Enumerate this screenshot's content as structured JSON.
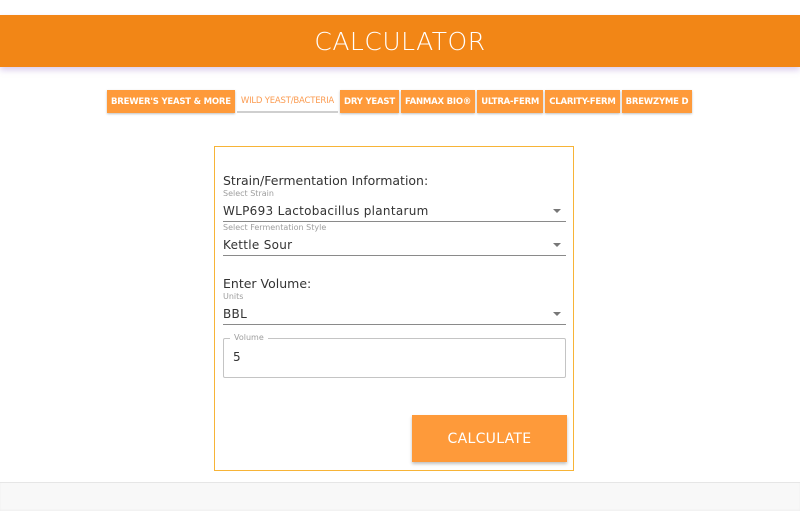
{
  "header": {
    "title": "CALCULATOR",
    "color": "#f28616"
  },
  "tabs": [
    {
      "label": "BREWER'S YEAST & MORE",
      "active": false
    },
    {
      "label": "WILD YEAST/BACTERIA",
      "active": true
    },
    {
      "label": "DRY YEAST",
      "active": false
    },
    {
      "label": "FANMAX BIO®",
      "active": false
    },
    {
      "label": "ULTRA-FERM",
      "active": false
    },
    {
      "label": "CLARITY-FERM",
      "active": false
    },
    {
      "label": "BREWZYME D",
      "active": false
    }
  ],
  "form": {
    "strain_section_title": "Strain/Fermentation Information:",
    "strain": {
      "label": "Select Strain",
      "value": "WLP693 Lactobacillus plantarum"
    },
    "style": {
      "label": "Select Fermentation Style",
      "value": "Kettle Sour"
    },
    "volume_section_title": "Enter Volume:",
    "units": {
      "label": "Units",
      "value": "BBL"
    },
    "volume": {
      "label": "Volume",
      "value": "5"
    },
    "calculate_label": "CALCULATE"
  }
}
